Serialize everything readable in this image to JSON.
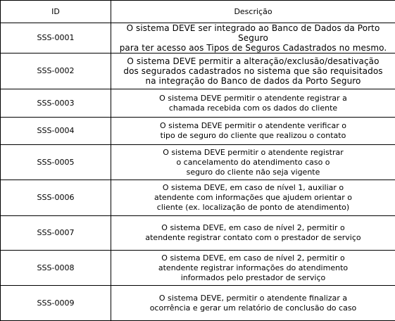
{
  "table": {
    "headers": {
      "id": "ID",
      "description": "Descrição"
    },
    "rows": [
      {
        "id": "SSS-0001",
        "description": "O sistema DEVE ser integrado ao Banco de Dados da Porto Seguro\npara ter acesso aos Tipos de Seguros Cadastrados no mesmo."
      },
      {
        "id": "SSS-0002",
        "description": "O sistema DEVE permitir a alteração/exclusão/desativação\ndos segurados cadastrados no sistema que são requisitados\nna integração do Banco de dados da Porto Seguro"
      },
      {
        "id": "SSS-0003",
        "description": "O sistema DEVE permitir o atendente registrar a\nchamada recebida com os dados do cliente"
      },
      {
        "id": "SSS-0004",
        "description": "O sistema DEVE permitir o atendente verificar o\ntipo de seguro do cliente que realizou o contato"
      },
      {
        "id": "SSS-0005",
        "description": "O sistema DEVE permitir o atendente registrar\no cancelamento do atendimento caso o\nseguro do cliente não seja vigente"
      },
      {
        "id": "SSS-0006",
        "description": "O sistema DEVE, em caso de nível 1, auxiliar o\natendente com informações que ajudem orientar o\ncliente (ex. localização de ponto de atendimento)"
      },
      {
        "id": "SSS-0007",
        "description": "O sistema DEVE, em caso de nível 2,  permitir o\natendente registrar contato com o prestador de serviço"
      },
      {
        "id": "SSS-0008",
        "description": "O sistema DEVE, em caso de nível 2,  permitir o\natendente registrar informações do atendimento\ninformados pelo prestador de serviço"
      },
      {
        "id": "SSS-0009",
        "description": "O sistema DEVE, permitir o atendente finalizar a\nocorrência e gerar um relatório de conclusão do caso"
      }
    ]
  }
}
